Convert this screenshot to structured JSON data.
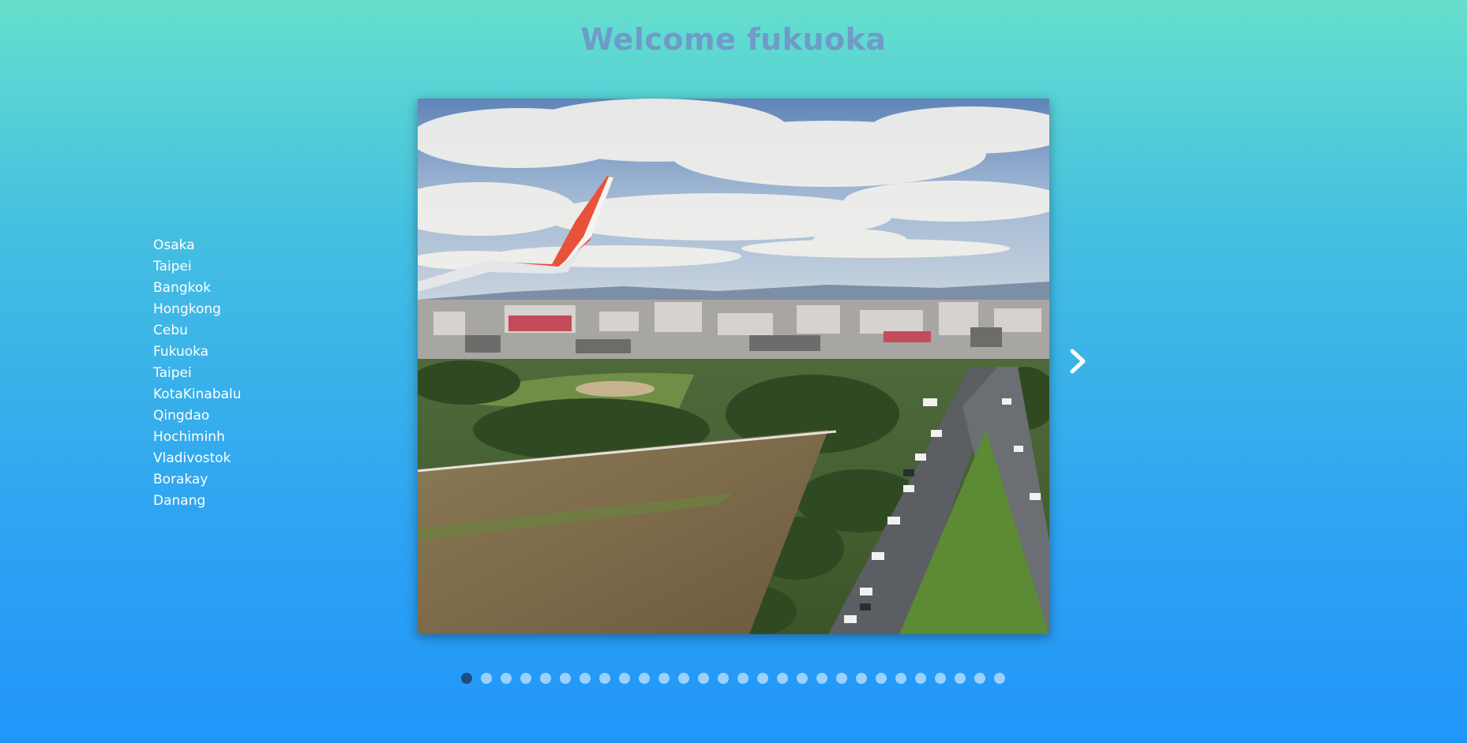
{
  "page": {
    "title": "Welcome fukuoka"
  },
  "colors": {
    "title": "#6f9bc9",
    "list_text": "#ffffff",
    "active_dot": "#1d4e7a",
    "background_top": "#66dfcd",
    "background_bottom": "#2196fa"
  },
  "sidebar": {
    "cities": [
      "Osaka",
      "Taipei",
      "Bangkok",
      "Hongkong",
      "Cebu",
      "Fukuoka",
      "Taipei",
      "KotaKinabalu",
      "Qingdao",
      "Hochiminh",
      "Vladivostok",
      "Borakay",
      "Danang"
    ]
  },
  "slider": {
    "image_icon": "airplane-window-city-photo",
    "next_icon": "chevron-right-icon",
    "total_slides": 28,
    "active_index": 0
  }
}
